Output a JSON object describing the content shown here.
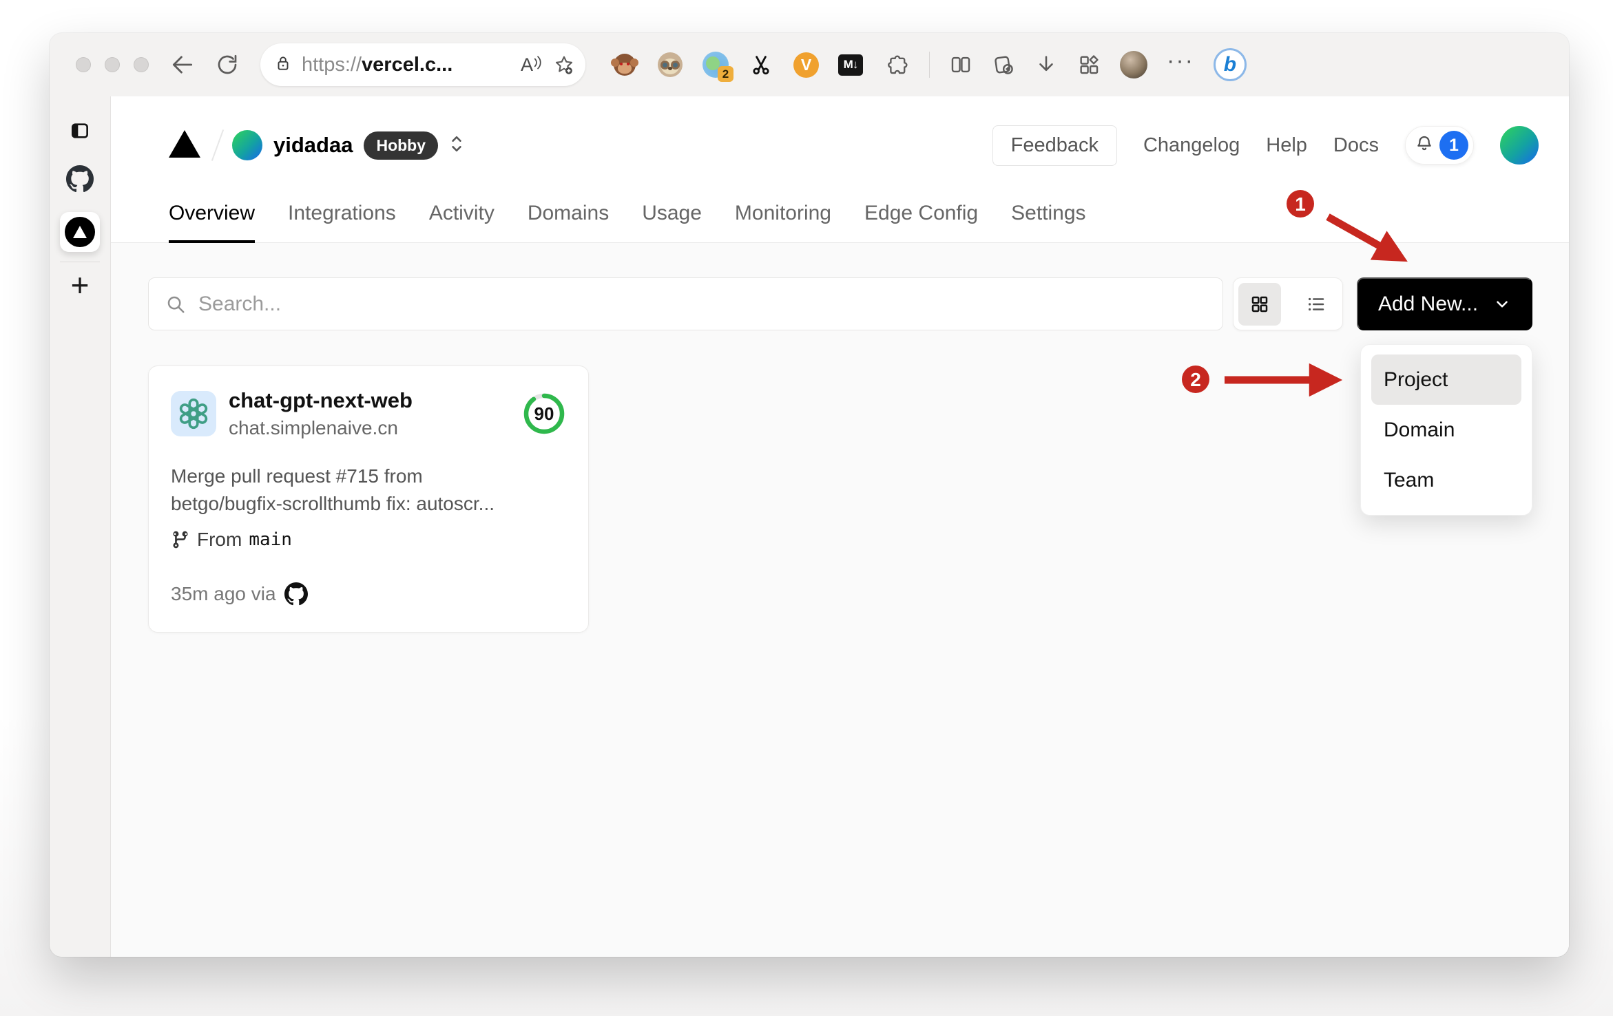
{
  "browser": {
    "url_prefix": "https://",
    "url_host": "vercel.c...",
    "read_aloud_glyph": "A",
    "ext_badge_count": "2",
    "vimium_label": "V",
    "markdown_label": "M↓",
    "more_glyph": "···",
    "bing_label": "b",
    "sidebar_plus": "+"
  },
  "header": {
    "team_name": "yidadaa",
    "plan_badge": "Hobby",
    "feedback_label": "Feedback",
    "nav_links": [
      "Changelog",
      "Help",
      "Docs"
    ],
    "notification_count": "1"
  },
  "tabs": {
    "items": [
      "Overview",
      "Integrations",
      "Activity",
      "Domains",
      "Usage",
      "Monitoring",
      "Edge Config",
      "Settings"
    ],
    "active": "Overview"
  },
  "controls": {
    "search_placeholder": "Search...",
    "add_new_label": "Add New..."
  },
  "card": {
    "name": "chat-gpt-next-web",
    "domain": "chat.simplenaive.cn",
    "score": "90",
    "score_percent": 90,
    "commit_line1": "Merge pull request #715 from",
    "commit_line2": "betgo/bugfix-scrollthumb fix: autoscr...",
    "from_label": "From",
    "branch_name": "main",
    "deploy_meta": "35m ago via"
  },
  "dropdown": {
    "items": [
      "Project",
      "Domain",
      "Team"
    ],
    "highlighted": "Project"
  },
  "annotations": {
    "step1": "1",
    "step2": "2"
  },
  "colors": {
    "annotation_red": "#c7271f",
    "score_green": "#2fb84c",
    "notification_blue": "#1d6ff2",
    "accent_black": "#000000"
  }
}
